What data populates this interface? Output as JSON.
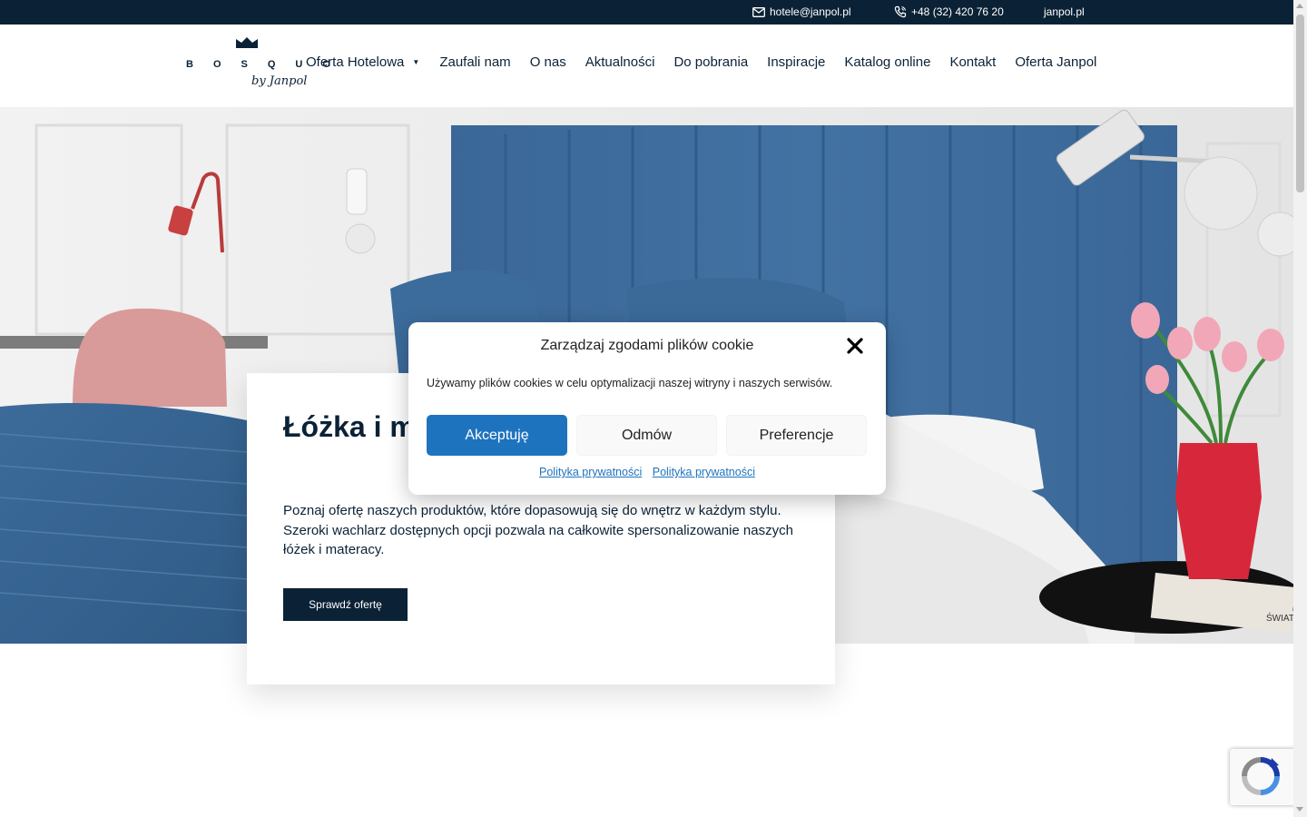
{
  "topbar": {
    "email": "hotele@janpol.pl",
    "phone": "+48 (32) 420 76 20",
    "site": "janpol.pl",
    "email_icon": "mail-icon",
    "phone_icon": "phone-icon"
  },
  "header": {
    "logo": {
      "wordmark": "BOSQUO",
      "tagline": "by Janpol"
    },
    "nav": [
      {
        "label": "Oferta Hotelowa",
        "has_dropdown": true
      },
      {
        "label": "Zaufali nam"
      },
      {
        "label": "O nas"
      },
      {
        "label": "Aktualności"
      },
      {
        "label": "Do pobrania"
      },
      {
        "label": "Inspiracje"
      },
      {
        "label": "Katalog online"
      },
      {
        "label": "Kontakt"
      },
      {
        "label": "Oferta Janpol"
      }
    ]
  },
  "hero": {
    "heading": "Łóżka i materace dla hoteli",
    "text": "Poznaj ofertę naszych produktów, które dopasowują się do wnętrz w każdym stylu. Szeroki wachlarz dostępnych opcji pozwala na całkowite spersonalizowanie naszych łóżek i materacy.",
    "cta": "Sprawdź ofertę",
    "image_book_text": "ŚWIAT OCEANÓW"
  },
  "cookie": {
    "title": "Zarządzaj zgodami plików cookie",
    "description": "Używamy plików cookies w celu optymalizacji naszej witryny i naszych serwisów.",
    "accept": "Akceptuję",
    "deny": "Odmów",
    "preferences": "Preferencje",
    "links": [
      "Polityka prywatności",
      "Polityka prywatności"
    ],
    "close_icon": "close-icon"
  },
  "colors": {
    "navy": "#0b2236",
    "accent": "#1e73be",
    "headboard": "#3f6fa0"
  }
}
